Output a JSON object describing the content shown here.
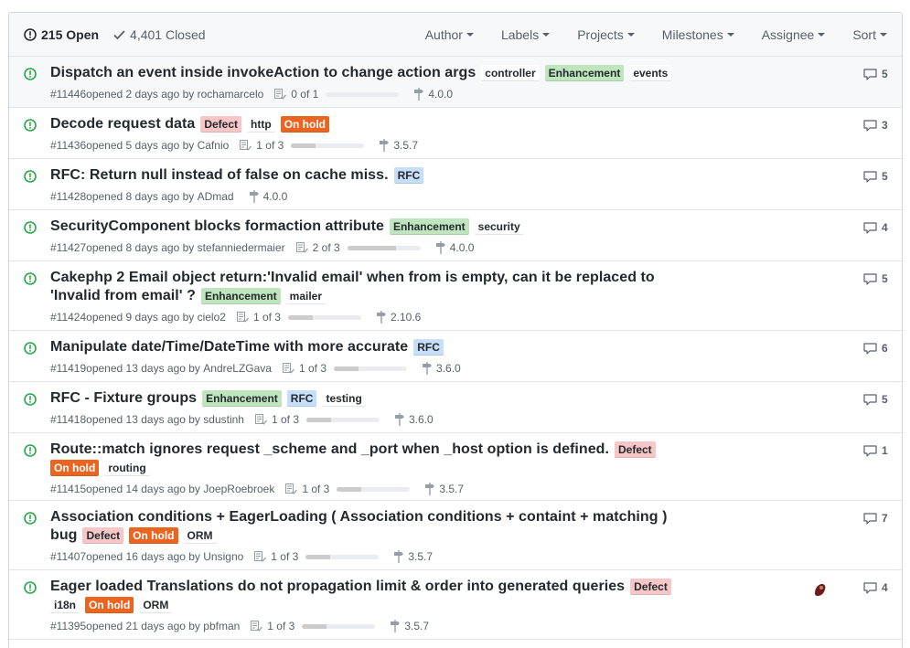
{
  "header": {
    "open_count": "215 Open",
    "closed_count": "4,401 Closed",
    "filters": [
      "Author",
      "Labels",
      "Projects",
      "Milestones",
      "Assignee",
      "Sort"
    ]
  },
  "label_colors": {
    "controller": {
      "bg": "#ffffff",
      "fg": "#24292e"
    },
    "Enhancement": {
      "bg": "#bfe5bf",
      "fg": "#24292e"
    },
    "events": {
      "bg": "#ffffff",
      "fg": "#24292e"
    },
    "Defect": {
      "bg": "#f7c6c7",
      "fg": "#24292e"
    },
    "http": {
      "bg": "#ffffff",
      "fg": "#24292e"
    },
    "On hold": {
      "bg": "#eb6420",
      "fg": "#ffffff"
    },
    "RFC": {
      "bg": "#c7def8",
      "fg": "#24292e"
    },
    "security": {
      "bg": "#ffffff",
      "fg": "#24292e"
    },
    "mailer": {
      "bg": "#ffffff",
      "fg": "#24292e"
    },
    "testing": {
      "bg": "#ffffff",
      "fg": "#24292e"
    },
    "routing": {
      "bg": "#ffffff",
      "fg": "#24292e"
    },
    "ORM": {
      "bg": "#ffffff",
      "fg": "#24292e"
    },
    "i18n": {
      "bg": "#ffffff",
      "fg": "#24292e"
    }
  },
  "colors": {
    "open_icon": "#28a745",
    "progress_fill": "#cccccc"
  },
  "issues": [
    {
      "lines": [
        {
          "title": "Dispatch an event inside invokeAction to change action args",
          "labels": [
            "controller",
            "Enhancement",
            "events"
          ]
        }
      ],
      "number": "#11446",
      "opened": "opened 2 days ago by",
      "author": "rochamarcelo",
      "tasks": "0 of 1",
      "progress": 0.0,
      "milestone": "4.0.0",
      "comments": "5",
      "avatar": false
    },
    {
      "lines": [
        {
          "title": "Decode request data",
          "labels": [
            "Defect",
            "http",
            "On hold"
          ]
        }
      ],
      "number": "#11436",
      "opened": "opened 5 days ago by",
      "author": "Cafnio",
      "tasks": "1 of 3",
      "progress": 0.333,
      "milestone": "3.5.7",
      "comments": "3",
      "avatar": false
    },
    {
      "lines": [
        {
          "title": "RFC: Return null instead of false on cache miss.",
          "labels": [
            "RFC"
          ]
        }
      ],
      "number": "#11428",
      "opened": "opened 8 days ago by",
      "author": "ADmad",
      "tasks": "",
      "progress": null,
      "milestone": "4.0.0",
      "comments": "5",
      "avatar": false
    },
    {
      "lines": [
        {
          "title": "SecurityComponent blocks formaction attribute",
          "labels": [
            "Enhancement",
            "security"
          ]
        }
      ],
      "number": "#11427",
      "opened": "opened 8 days ago by",
      "author": "stefanniedermaier",
      "tasks": "2 of 3",
      "progress": 0.667,
      "milestone": "4.0.0",
      "comments": "4",
      "avatar": false
    },
    {
      "lines": [
        {
          "title": "Cakephp 2 Email object return:'Invalid email' when from is empty, can it be replaced to",
          "labels": []
        },
        {
          "title": "'Invalid from email' ?",
          "labels": [
            "Enhancement",
            "mailer"
          ]
        }
      ],
      "number": "#11424",
      "opened": "opened 9 days ago by",
      "author": "cielo2",
      "tasks": "1 of 3",
      "progress": 0.333,
      "milestone": "2.10.6",
      "comments": "5",
      "avatar": false
    },
    {
      "lines": [
        {
          "title": "Manipulate date/Time/DateTime with more accurate",
          "labels": [
            "RFC"
          ]
        }
      ],
      "number": "#11419",
      "opened": "opened 13 days ago by",
      "author": "AndreLZGava",
      "tasks": "1 of 3",
      "progress": 0.333,
      "milestone": "3.6.0",
      "comments": "6",
      "avatar": false
    },
    {
      "lines": [
        {
          "title": "RFC - Fixture groups",
          "labels": [
            "Enhancement",
            "RFC",
            "testing"
          ]
        }
      ],
      "number": "#11418",
      "opened": "opened 13 days ago by",
      "author": "sdustinh",
      "tasks": "1 of 3",
      "progress": 0.333,
      "milestone": "3.6.0",
      "comments": "5",
      "avatar": false
    },
    {
      "lines": [
        {
          "title": "Route::match ignores request _scheme and _port when _host option is defined.",
          "labels": [
            "Defect"
          ]
        },
        {
          "title": "",
          "labels": [
            "On hold",
            "routing"
          ]
        }
      ],
      "number": "#11415",
      "opened": "opened 14 days ago by",
      "author": "JoepRoebroek",
      "tasks": "1 of 3",
      "progress": 0.333,
      "milestone": "3.5.7",
      "comments": "1",
      "avatar": false
    },
    {
      "lines": [
        {
          "title": "Association conditions + EagerLoading ( Association conditions + containt + matching )",
          "labels": []
        },
        {
          "title": "bug",
          "labels": [
            "Defect",
            "On hold",
            "ORM"
          ]
        }
      ],
      "number": "#11407",
      "opened": "opened 16 days ago by",
      "author": "Unsigno",
      "tasks": "1 of 3",
      "progress": 0.333,
      "milestone": "3.5.7",
      "comments": "7",
      "avatar": false
    },
    {
      "lines": [
        {
          "title": "Eager loaded Translations do not propagation limit & order into generated queries",
          "labels": [
            "Defect"
          ]
        },
        {
          "title": "",
          "labels": [
            "i18n",
            "On hold",
            "ORM"
          ]
        }
      ],
      "number": "#11395",
      "opened": "opened 21 days ago by",
      "author": "pbfman",
      "tasks": "1 of 3",
      "progress": 0.333,
      "milestone": "3.5.7",
      "comments": "4",
      "avatar": true
    }
  ]
}
